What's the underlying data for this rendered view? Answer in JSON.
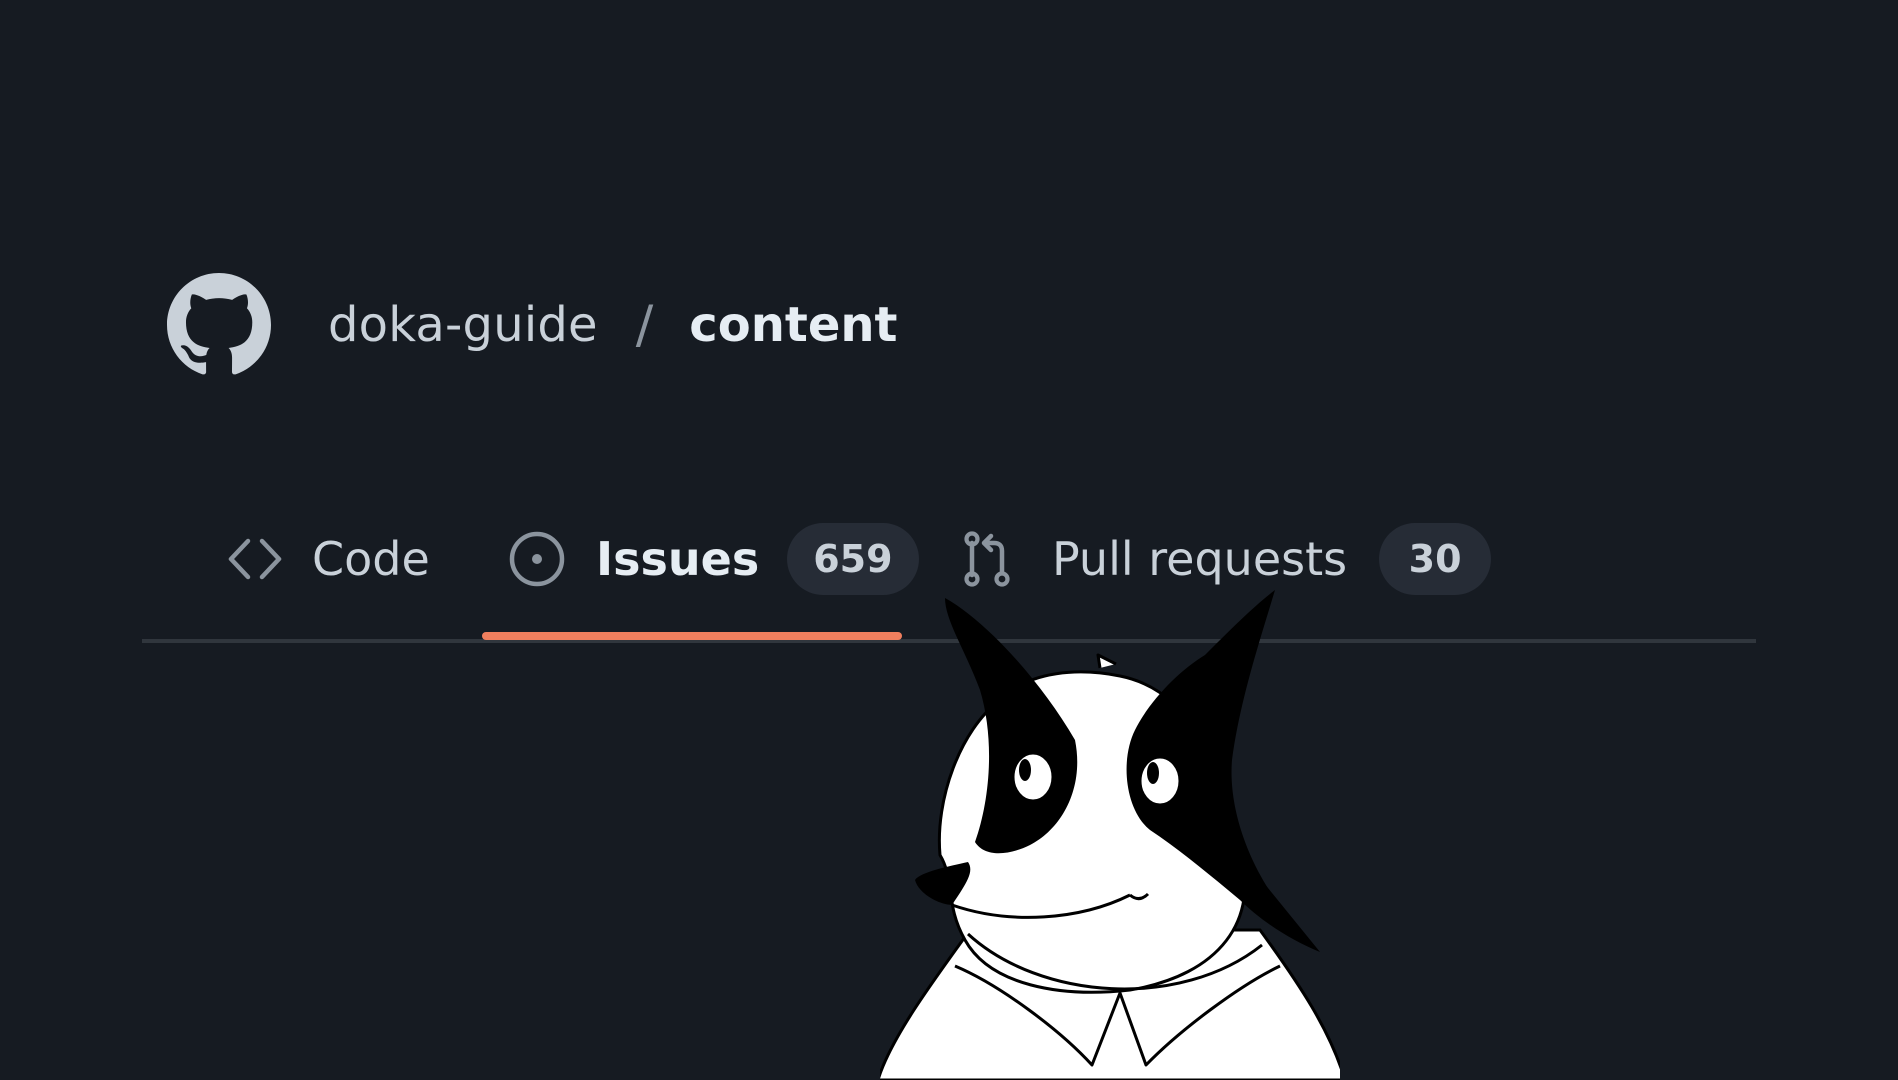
{
  "repo": {
    "owner": "doka-guide",
    "separator": "/",
    "name": "content",
    "logo_icon": "github-octocat-icon"
  },
  "tabs": [
    {
      "label": "Code",
      "icon": "code-icon",
      "selected": false
    },
    {
      "label": "Issues",
      "icon": "issue-opened-icon",
      "count": "659",
      "selected": true
    },
    {
      "label": "Pull requests",
      "icon": "git-pull-request-icon",
      "count": "30",
      "selected": false
    }
  ],
  "colors": {
    "background": "#161b22",
    "text": "#c9d1d9",
    "muted": "#8b949e",
    "counter_bg": "#262c36",
    "active_underline": "#f07f5e",
    "divider": "#30363d"
  },
  "mascot": {
    "icon": "dog-mascot-illustration"
  }
}
